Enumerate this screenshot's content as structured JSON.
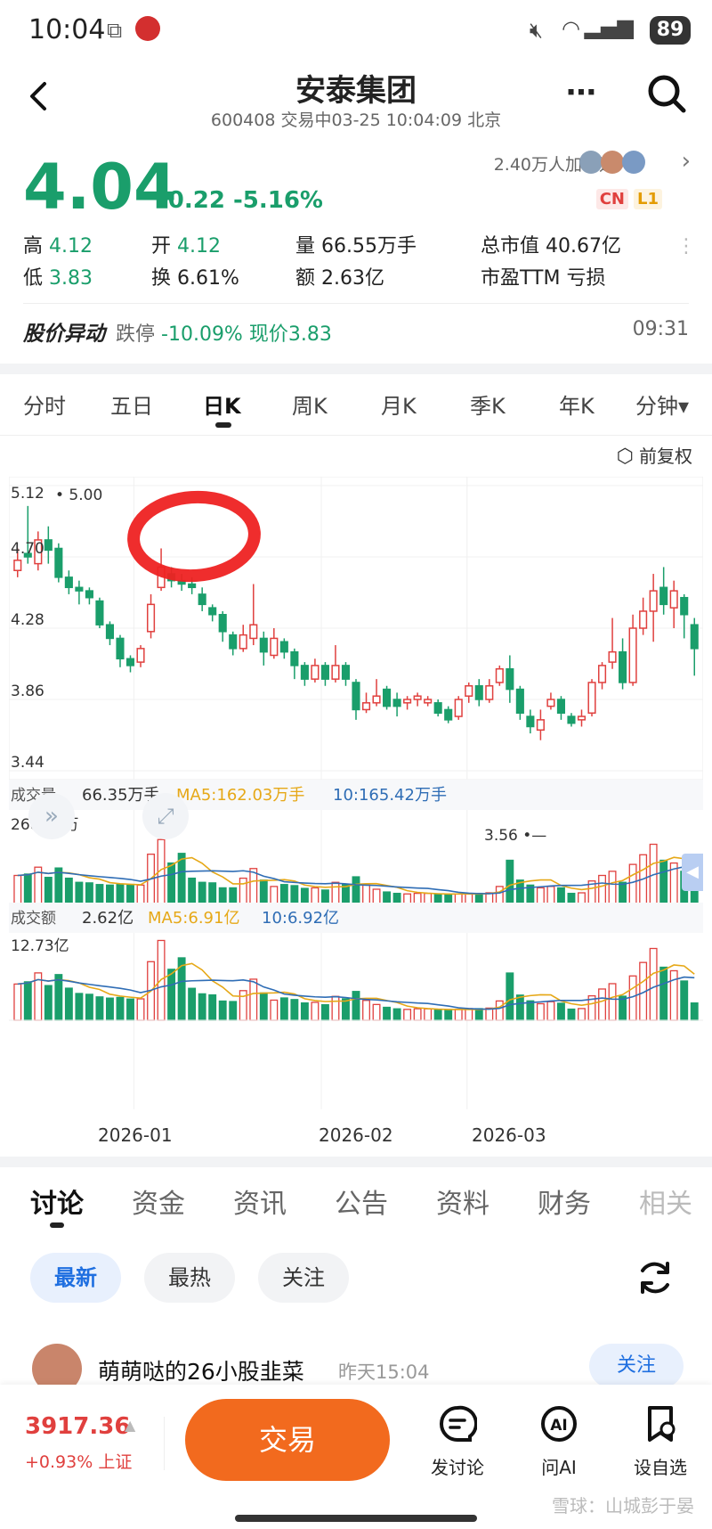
{
  "status_bar": {
    "time": "10:04",
    "battery": "89"
  },
  "header": {
    "title": "安泰集团",
    "subtitle": "600408 交易中03-25 10:04:09 北京"
  },
  "quote": {
    "price": "4.04",
    "change": "-0.22 -5.16%",
    "watchers": "2.40万人加自选",
    "tags": [
      "CN",
      "L1"
    ],
    "stats": [
      {
        "label": "高",
        "value": "4.12",
        "color": "green"
      },
      {
        "label": "开",
        "value": "4.12",
        "color": "green"
      },
      {
        "label": "量",
        "value": "66.55万手",
        "color": "plain"
      },
      {
        "label": "总市值",
        "value": "40.67亿",
        "color": "plain"
      },
      {
        "label": "低",
        "value": "3.83",
        "color": "green"
      },
      {
        "label": "换",
        "value": "6.61%",
        "color": "plain"
      },
      {
        "label": "额",
        "value": "2.63亿",
        "color": "plain"
      },
      {
        "label": "市盈TTM",
        "value": "亏损",
        "color": "plain"
      }
    ]
  },
  "alert": {
    "heading": "股价异动",
    "text_prefix": "跌停",
    "text_value": "-10.09% 现价3.83",
    "time": "09:31"
  },
  "period_tabs": [
    "分时",
    "五日",
    "日K",
    "周K",
    "月K",
    "季K",
    "年K",
    "分钟▾"
  ],
  "active_period": "日K",
  "adjust_label": "前复权",
  "volume_panel": {
    "label": "成交量",
    "value": "66.35万手",
    "ma5": "MA5:162.03万手",
    "ma10": "10:165.42万手",
    "axis_max": "268.57万"
  },
  "amount_panel": {
    "label": "成交额",
    "value": "2.62亿",
    "ma5": "MA5:6.91亿",
    "ma10": "10:6.92亿",
    "axis_max": "12.73亿"
  },
  "x_axis_dates": [
    "2026-01",
    "2026-02",
    "2026-03"
  ],
  "chart_data": {
    "type": "candlestick",
    "price_axis_ticks": [
      "5.12",
      "4.70",
      "4.28",
      "3.86",
      "3.44"
    ],
    "ylim": [
      3.44,
      5.12
    ],
    "annotations": [
      "5.00",
      "3.56"
    ],
    "colors": {
      "up": "#e0403e",
      "down": "#1a9e6b",
      "ma5": "#e6a817",
      "ma10": "#2f6db5",
      "highlight": "#ee2222"
    },
    "candles": [
      [
        4.62,
        4.68,
        4.75,
        4.58
      ],
      [
        4.72,
        4.7,
        5.0,
        4.66
      ],
      [
        4.66,
        4.8,
        4.85,
        4.62
      ],
      [
        4.8,
        4.74,
        4.88,
        4.66
      ],
      [
        4.75,
        4.58,
        4.78,
        4.55
      ],
      [
        4.58,
        4.52,
        4.62,
        4.48
      ],
      [
        4.52,
        4.5,
        4.56,
        4.42
      ],
      [
        4.5,
        4.46,
        4.52,
        4.42
      ],
      [
        4.44,
        4.3,
        4.46,
        4.28
      ],
      [
        4.3,
        4.22,
        4.32,
        4.18
      ],
      [
        4.22,
        4.1,
        4.24,
        4.05
      ],
      [
        4.1,
        4.06,
        4.12,
        4.02
      ],
      [
        4.08,
        4.16,
        4.18,
        4.05
      ],
      [
        4.26,
        4.42,
        4.48,
        4.22
      ],
      [
        4.52,
        4.64,
        4.75,
        4.5
      ],
      [
        4.6,
        4.56,
        4.64,
        4.52
      ],
      [
        4.56,
        4.54,
        4.6,
        4.5
      ],
      [
        4.54,
        4.52,
        4.58,
        4.48
      ],
      [
        4.48,
        4.42,
        4.52,
        4.38
      ],
      [
        4.4,
        4.36,
        4.42,
        4.32
      ],
      [
        4.36,
        4.26,
        4.38,
        4.2
      ],
      [
        4.24,
        4.16,
        4.26,
        4.12
      ],
      [
        4.16,
        4.24,
        4.3,
        4.14
      ],
      [
        4.22,
        4.3,
        4.54,
        4.18
      ],
      [
        4.22,
        4.14,
        4.26,
        4.06
      ],
      [
        4.12,
        4.22,
        4.28,
        4.1
      ],
      [
        4.2,
        4.14,
        4.22,
        4.1
      ],
      [
        4.14,
        4.06,
        4.16,
        3.98
      ],
      [
        4.06,
        3.98,
        4.08,
        3.94
      ],
      [
        3.98,
        4.06,
        4.1,
        3.96
      ],
      [
        4.06,
        3.98,
        4.08,
        3.94
      ],
      [
        3.98,
        4.06,
        4.18,
        3.96
      ],
      [
        4.06,
        3.98,
        4.08,
        3.94
      ],
      [
        3.96,
        3.8,
        3.98,
        3.74
      ],
      [
        3.8,
        3.84,
        3.9,
        3.78
      ],
      [
        3.84,
        3.88,
        3.98,
        3.82
      ],
      [
        3.92,
        3.82,
        3.94,
        3.8
      ],
      [
        3.86,
        3.82,
        3.9,
        3.76
      ],
      [
        3.84,
        3.86,
        3.88,
        3.8
      ],
      [
        3.86,
        3.88,
        3.9,
        3.82
      ],
      [
        3.84,
        3.86,
        3.88,
        3.82
      ],
      [
        3.84,
        3.78,
        3.86,
        3.76
      ],
      [
        3.8,
        3.74,
        3.82,
        3.72
      ],
      [
        3.76,
        3.86,
        3.88,
        3.74
      ],
      [
        3.88,
        3.94,
        3.96,
        3.84
      ],
      [
        3.94,
        3.86,
        3.98,
        3.82
      ],
      [
        3.86,
        3.94,
        3.98,
        3.84
      ],
      [
        3.96,
        4.04,
        4.06,
        3.94
      ],
      [
        4.04,
        3.92,
        4.12,
        3.84
      ],
      [
        3.92,
        3.78,
        3.94,
        3.74
      ],
      [
        3.76,
        3.7,
        3.8,
        3.66
      ],
      [
        3.68,
        3.74,
        3.8,
        3.62
      ],
      [
        3.82,
        3.86,
        3.9,
        3.8
      ],
      [
        3.86,
        3.78,
        3.88,
        3.74
      ],
      [
        3.76,
        3.72,
        3.78,
        3.7
      ],
      [
        3.74,
        3.76,
        3.8,
        3.7
      ],
      [
        3.78,
        3.96,
        3.98,
        3.76
      ],
      [
        3.96,
        4.06,
        4.08,
        3.92
      ],
      [
        4.08,
        4.14,
        4.34,
        4.04
      ],
      [
        4.14,
        3.96,
        4.22,
        3.92
      ],
      [
        3.96,
        4.28,
        4.36,
        3.94
      ],
      [
        4.28,
        4.38,
        4.46,
        4.24
      ],
      [
        4.38,
        4.5,
        4.6,
        4.2
      ],
      [
        4.52,
        4.42,
        4.64,
        4.36
      ],
      [
        4.4,
        4.5,
        4.56,
        4.28
      ],
      [
        4.46,
        4.36,
        4.48,
        4.22
      ],
      [
        4.3,
        4.16,
        4.34,
        4.0
      ]
    ],
    "volume_axis_max": 268.57,
    "volume": [
      1.05,
      1.1,
      1.35,
      0.98,
      1.32,
      0.95,
      0.8,
      0.78,
      0.72,
      0.7,
      0.74,
      0.7,
      0.7,
      1.82,
      2.35,
      1.5,
      1.85,
      0.95,
      0.8,
      0.78,
      0.6,
      0.6,
      0.95,
      1.3,
      0.88,
      0.65,
      0.72,
      0.68,
      0.58,
      0.6,
      0.52,
      0.8,
      0.72,
      1.0,
      0.7,
      0.55,
      0.45,
      0.4,
      0.38,
      0.4,
      0.4,
      0.36,
      0.35,
      0.38,
      0.4,
      0.4,
      0.42,
      0.65,
      1.6,
      0.88,
      0.7,
      0.6,
      0.65,
      0.6,
      0.4,
      0.42,
      0.85,
      1.05,
      1.2,
      0.8,
      1.45,
      1.8,
      2.18,
      1.6,
      1.5,
      1.2,
      0.55
    ],
    "amount_axis_max": 12.73
  },
  "bottom_tabs": [
    "讨论",
    "资金",
    "资讯",
    "公告",
    "资料",
    "财务",
    "相关"
  ],
  "active_bottom_tab": "讨论",
  "filter_chips": [
    "最新",
    "最热",
    "关注"
  ],
  "post": {
    "user": "萌萌哒的26小股韭菜",
    "time": "昨天15:04",
    "follow": "关注"
  },
  "footer": {
    "index_value": "3917.36",
    "index_change": "+0.93% 上证",
    "trade_label": "交易",
    "buttons": [
      "发讨论",
      "问AI",
      "设自选"
    ],
    "watermark": "雪球：山城彭于晏"
  }
}
